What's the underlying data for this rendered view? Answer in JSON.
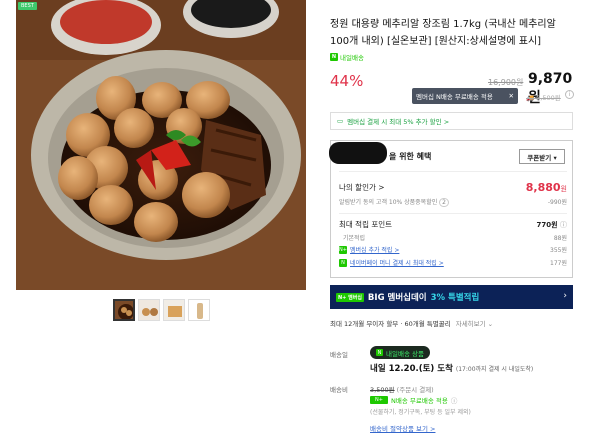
{
  "product": {
    "badge": "BEST",
    "title": "정원 대용량 메추리알 장조림 1.7kg (국내산 메추리알 100개 내외) [실온보관] [원산지:상세설명에 표시]",
    "delivery_tag": "내일배송",
    "discount": "44%",
    "original_price": "16,900원",
    "sale_price": "9,870원",
    "tooltip": "멤버십 N배송 무료배송 적용",
    "shipping_strike": "3,500원",
    "card_promo": "멤버십 결제 시 최대 5% 추가 할인 >"
  },
  "benefits": {
    "heading": "을 위한 혜택",
    "coupon_button": "쿠폰받기 ▾",
    "discount_label": "나의 할인가 >",
    "discount_amount": "8,880",
    "discount_unit": "원",
    "coupon_note": "알림받기 동의 고객 10% 상품중복할인",
    "coupon_note_count": "2",
    "coupon_value": "-990원",
    "points_label": "최대 적립 포인트",
    "points_value": "770원",
    "basic_label": "기본적립",
    "basic_value": "88원",
    "membership_label": "멤버십 추가 적립 >",
    "membership_value": "355원",
    "naverpay_label": "네이버페이 머니 결제 시 최대 적립 >",
    "naverpay_value": "177원"
  },
  "banner": {
    "nplus": "N+ 멤버십",
    "text": "BIG 멤버십데이",
    "highlight": "3% 특별적립",
    "arrow": "›"
  },
  "installment": {
    "text": "최대 12개월 무이자 할부 · 60개월 특별꿀리",
    "more": "자세히보기 ⌄"
  },
  "delivery": {
    "label": "배송일",
    "badge": "내일배송 상품",
    "arrive": "내일 12.20.(토) 도착",
    "arrive_note": "(17:00까지 결제 시 내일도착)",
    "fee_label": "배송비",
    "fee_strike": "3,500원",
    "fee_note": "(주문시 결제)",
    "free_label": "N배송 무료배송 적용",
    "free_note": "(선물하기, 정기구독, 부팅 등 일부 제외)",
    "fee_link": "배송비 절약상품 보기 >"
  },
  "colors": {
    "accent_red": "#e0334a",
    "naver_green": "#1ec800",
    "banner_navy": "#0c2257"
  }
}
